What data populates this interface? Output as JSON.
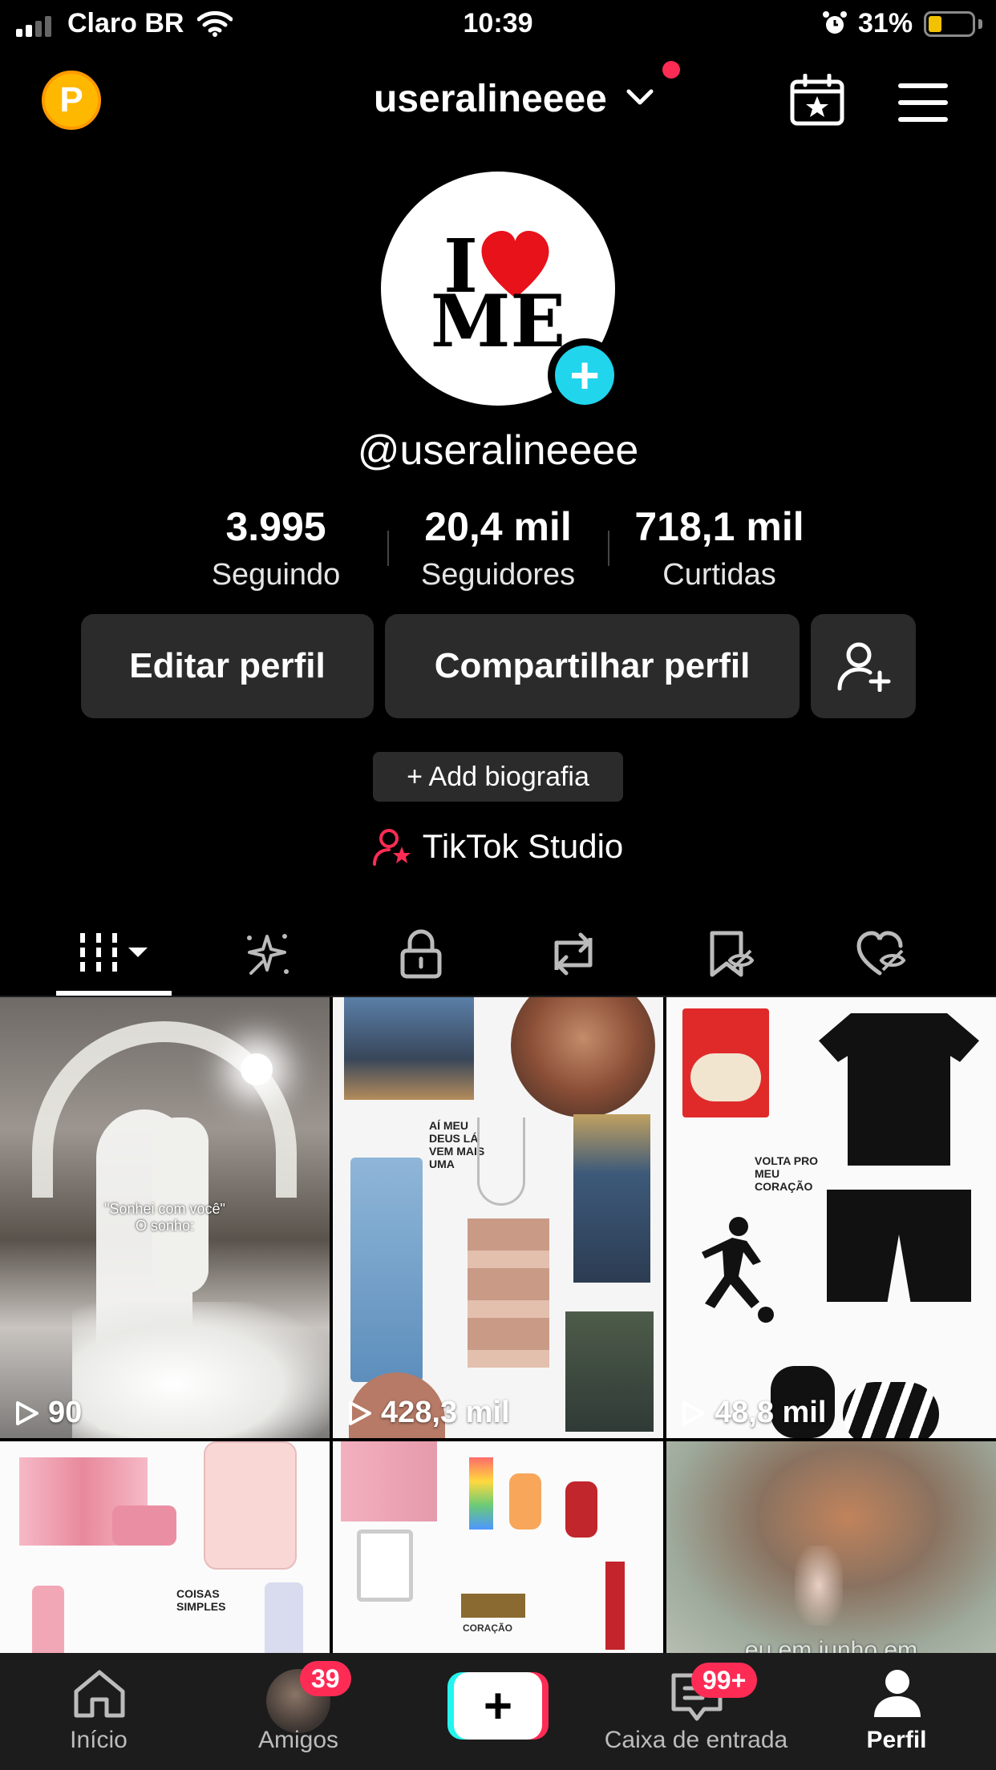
{
  "status_bar": {
    "carrier": "Claro BR",
    "time": "10:39",
    "battery_percent": "31%",
    "battery_level": 0.31,
    "signal_bars": 2
  },
  "header": {
    "username": "useralineeee",
    "coin_letter": "P",
    "icons": [
      "coin-icon",
      "chevron-down-icon",
      "calendar-star-icon",
      "hamburger-menu-icon"
    ]
  },
  "profile": {
    "avatar_text_top": "I",
    "avatar_text_bottom": "ME",
    "handle": "@useralineeee"
  },
  "stats": [
    {
      "value": "3.995",
      "label": "Seguindo"
    },
    {
      "value": "20,4 mil",
      "label": "Seguidores"
    },
    {
      "value": "718,1 mil",
      "label": "Curtidas"
    }
  ],
  "actions": {
    "edit": "Editar perfil",
    "share": "Compartilhar perfil",
    "add_bio": "+ Add biografia",
    "studio": "TikTok Studio"
  },
  "tabs": [
    {
      "name": "videos",
      "icon": "grid-icon",
      "active": true
    },
    {
      "name": "highlights",
      "icon": "sparkle-icon"
    },
    {
      "name": "private",
      "icon": "lock-icon"
    },
    {
      "name": "reposts",
      "icon": "repost-icon"
    },
    {
      "name": "favorites",
      "icon": "bookmark-hidden-icon"
    },
    {
      "name": "liked",
      "icon": "heart-hidden-icon"
    }
  ],
  "videos": [
    {
      "views": "90",
      "caption": "\"Sonhei com você\"\nO sonho:"
    },
    {
      "views": "428,3 mil",
      "caption": "AÍ MEU DEUS LÁ VEM MAIS UMA"
    },
    {
      "views": "48,8 mil",
      "caption": "VOLTA PRO MEU CORAÇÃO"
    },
    {
      "views": "",
      "caption": "COISAS SIMPLES"
    },
    {
      "views": "",
      "caption": "CORAÇÃO"
    },
    {
      "views": "",
      "caption": "eu em junho em"
    }
  ],
  "nav": {
    "home": "Início",
    "friends": "Amigos",
    "friends_badge": "39",
    "inbox": "Caixa de entrada",
    "inbox_badge": "99+",
    "profile": "Perfil"
  },
  "colors": {
    "accent_pink": "#fe2c55",
    "accent_cyan": "#25f4ee",
    "badge_cyan": "#20d5ec",
    "coin": "#ffb800"
  }
}
